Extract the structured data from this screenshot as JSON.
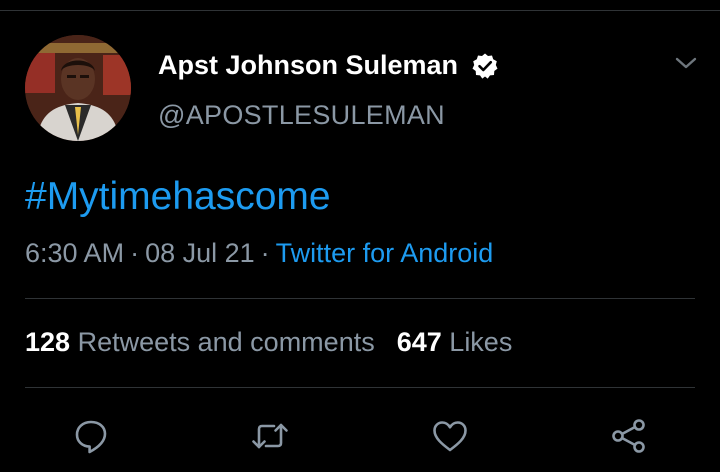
{
  "tweet": {
    "author": {
      "display_name": "Apst Johnson Suleman",
      "handle": "@APOSTLESULEMAN",
      "verified": true
    },
    "text": "#Mytimehascome",
    "time": "6:30 AM",
    "date": "08 Jul 21",
    "separator": "·",
    "source": "Twitter for Android"
  },
  "stats": {
    "retweets_count": "128",
    "retweets_label": "Retweets and comments",
    "likes_count": "647",
    "likes_label": "Likes"
  },
  "actions": [
    {
      "icon": "reply-icon"
    },
    {
      "icon": "retweet-icon"
    },
    {
      "icon": "like-icon"
    },
    {
      "icon": "share-icon"
    }
  ],
  "colors": {
    "background": "#000000",
    "link": "#1d9bf0",
    "muted": "#8b98a5",
    "divider": "#2f3336"
  }
}
